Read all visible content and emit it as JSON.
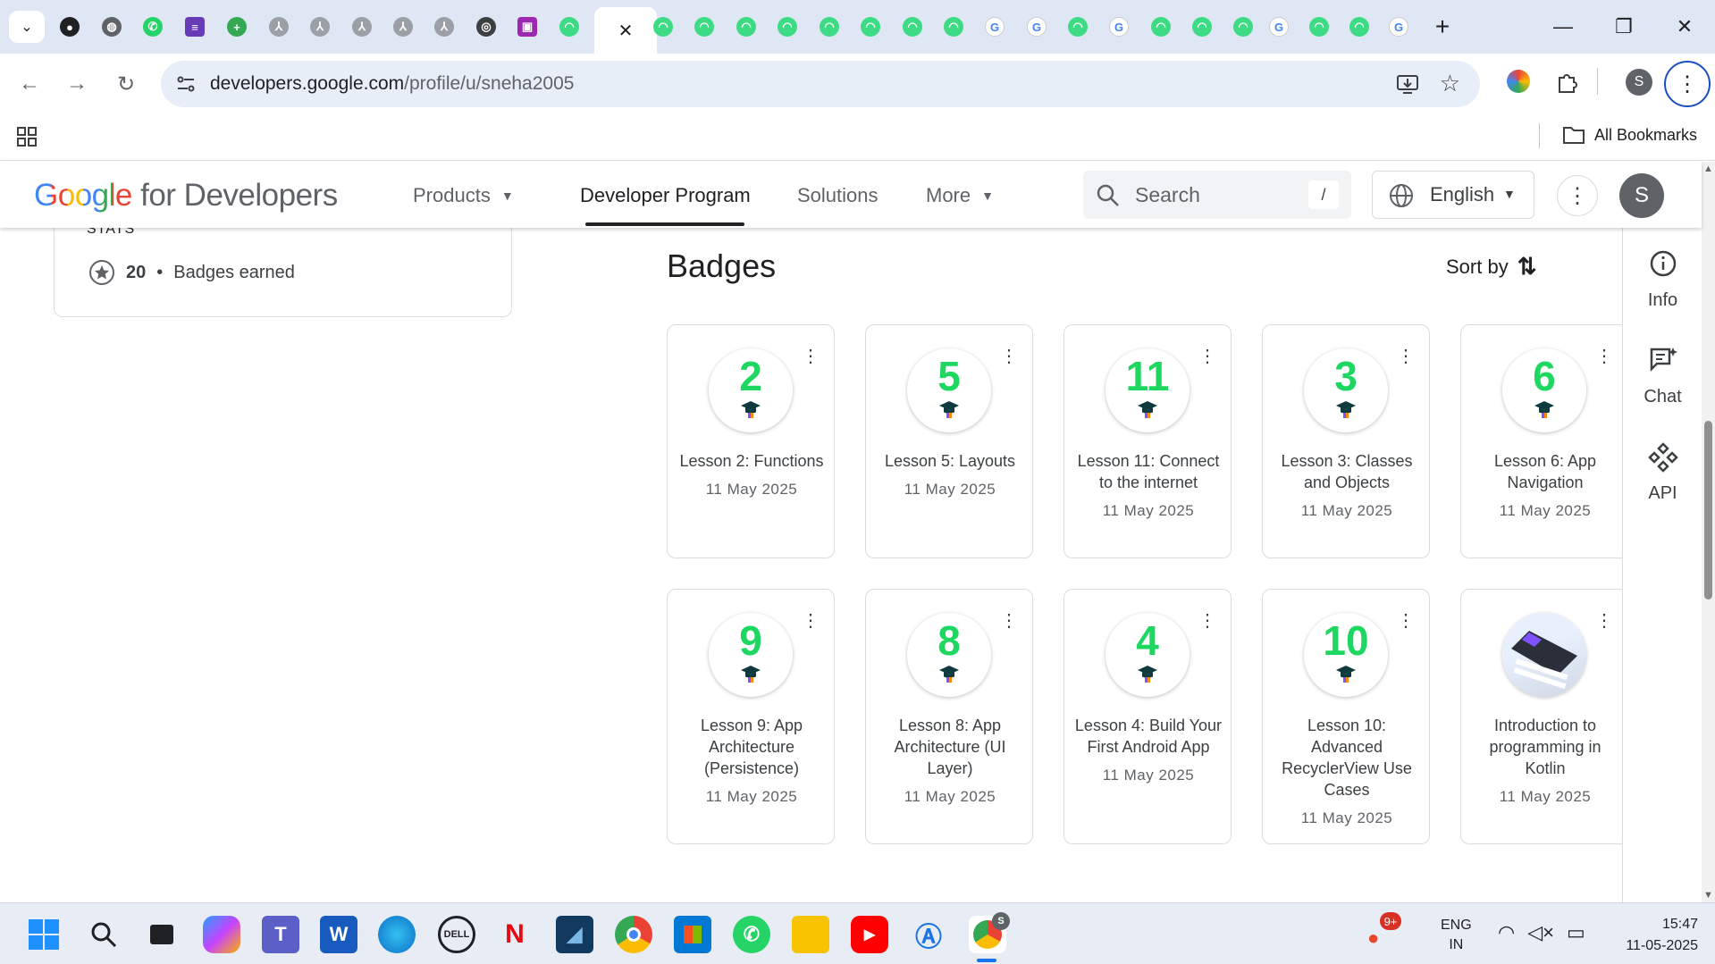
{
  "browser": {
    "url_domain": "developers.google.com",
    "url_path": "/profile/u/sneha2005",
    "bookmarks_label": "All Bookmarks",
    "profile_initial": "S",
    "tab_close_glyph": "✕",
    "new_tab_glyph": "+"
  },
  "site": {
    "logo_google": "Google",
    "logo_rest": "for Developers",
    "nav": {
      "products": "Products",
      "developer_program": "Developer Program",
      "solutions": "Solutions",
      "more": "More"
    },
    "search_placeholder": "Search",
    "search_shortcut": "/",
    "language": "English",
    "avatar_initial": "S"
  },
  "stats": {
    "heading": "STATS",
    "badges_count": "20",
    "badges_label": "Badges earned"
  },
  "badges": {
    "title": "Badges",
    "sort_label": "Sort by",
    "cards": [
      {
        "number": "2",
        "title": "Lesson 2: Functions",
        "date": "11 May 2025"
      },
      {
        "number": "5",
        "title": "Lesson 5: Layouts",
        "date": "11 May 2025"
      },
      {
        "number": "11",
        "title": "Lesson 11: Connect to the internet",
        "date": "11 May 2025"
      },
      {
        "number": "3",
        "title": "Lesson 3: Classes and Objects",
        "date": "11 May 2025"
      },
      {
        "number": "6",
        "title": "Lesson 6: App Navigation",
        "date": "11 May 2025"
      },
      {
        "number": "9",
        "title": "Lesson 9: App Architecture (Persistence)",
        "date": "11 May 2025"
      },
      {
        "number": "8",
        "title": "Lesson 8: App Architecture (UI Layer)",
        "date": "11 May 2025"
      },
      {
        "number": "4",
        "title": "Lesson 4: Build Your First Android App",
        "date": "11 May 2025"
      },
      {
        "number": "10",
        "title": "Lesson 10: Advanced RecyclerView Use Cases",
        "date": "11 May 2025"
      },
      {
        "number": "",
        "title": "Introduction to programming in Kotlin",
        "date": "11 May 2025"
      }
    ]
  },
  "rail": {
    "info": "Info",
    "chat": "Chat",
    "api": "API"
  },
  "taskbar": {
    "lang_line1": "ENG",
    "lang_line2": "IN",
    "time": "15:47",
    "date": "11-05-2025",
    "notif_count": "9+",
    "chrome_profile": "S"
  },
  "colors": {
    "badge_number": "#1ed760",
    "tabstrip_bg": "#dfe6f4",
    "omnibox_bg": "#e8eef8"
  }
}
